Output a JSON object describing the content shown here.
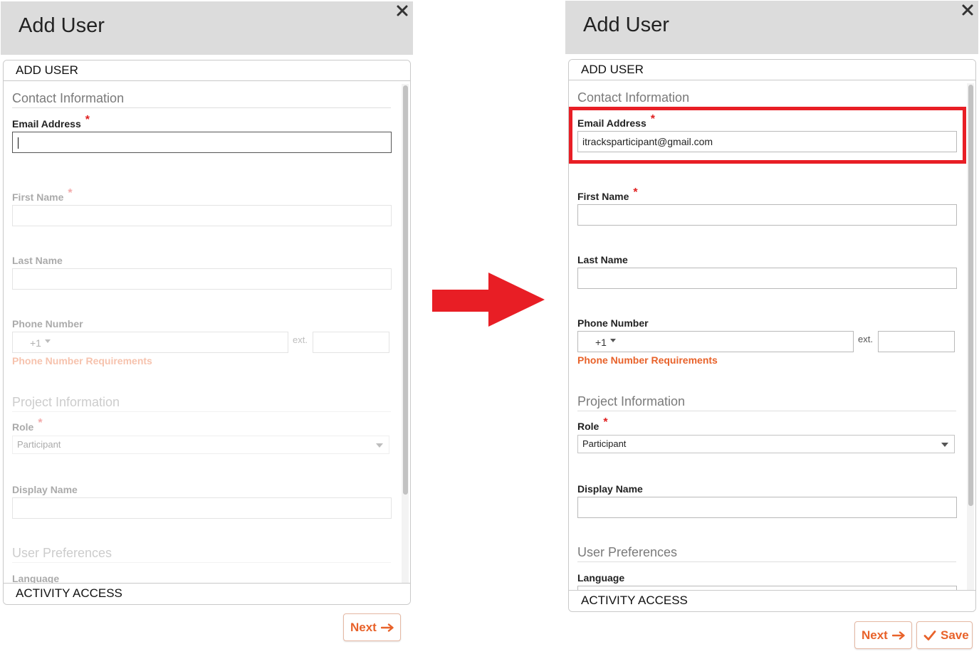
{
  "colors": {
    "accent": "#e8622a",
    "required": "#e02020",
    "highlight": "#e81e25",
    "arrow": "#e81e25",
    "header_bg": "#dcdcdc"
  },
  "icons": {
    "close": "close-icon",
    "next": "arrow-right-icon",
    "save": "check-icon",
    "dropdown": "chevron-down-icon",
    "transition": "arrow-right-icon"
  },
  "left": {
    "title": "Add User",
    "add_user_tab": "ADD USER",
    "activity_access_tab": "ACTIVITY ACCESS",
    "contact_section": "Contact Information",
    "email_label": "Email Address",
    "email_value": "",
    "first_name_label": "First Name",
    "last_name_label": "Last Name",
    "phone_label": "Phone Number",
    "phone_code": "+1",
    "ext_label": "ext.",
    "phone_requirements": "Phone Number Requirements",
    "project_section": "Project Information",
    "role_label": "Role",
    "role_value": "Participant",
    "display_name_label": "Display Name",
    "prefs_section": "User Preferences",
    "language_label": "Language",
    "next_button": "Next",
    "required_mark": "*"
  },
  "right": {
    "title": "Add User",
    "add_user_tab": "ADD USER",
    "activity_access_tab": "ACTIVITY ACCESS",
    "contact_section": "Contact Information",
    "email_label": "Email Address",
    "email_value": "itracksparticipant@gmail.com",
    "first_name_label": "First Name",
    "last_name_label": "Last Name",
    "phone_label": "Phone Number",
    "phone_code": "+1",
    "ext_label": "ext.",
    "phone_requirements": "Phone Number Requirements",
    "project_section": "Project Information",
    "role_label": "Role",
    "role_value": "Participant",
    "display_name_label": "Display Name",
    "prefs_section": "User Preferences",
    "language_label": "Language",
    "next_button": "Next",
    "save_button": "Save",
    "required_mark": "*"
  }
}
